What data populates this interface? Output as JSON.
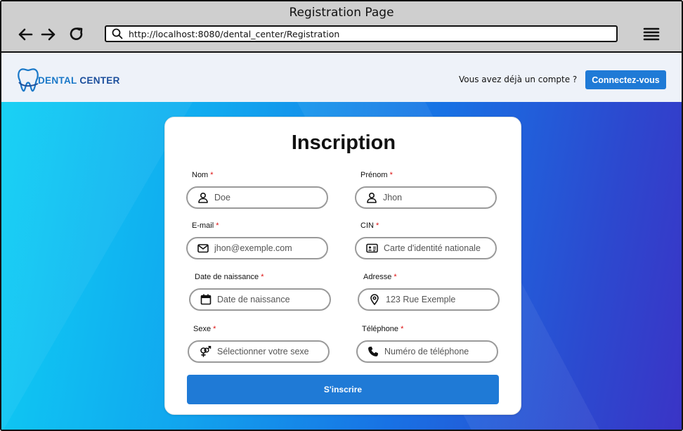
{
  "window": {
    "title": "Registration Page"
  },
  "browser": {
    "url": "http://localhost:8080/dental_center/Registration",
    "back_icon": "arrow-left-icon",
    "forward_icon": "arrow-right-icon",
    "reload_icon": "reload-icon",
    "search_icon": "search-icon",
    "menu_icon": "hamburger-menu-icon"
  },
  "header": {
    "logo": {
      "text_part1": "DENTAL",
      "text_part2": " CENTER",
      "icon": "tooth-icon"
    },
    "account_prompt": "Vous avez déjà un compte ?",
    "login_label": "Connectez-vous"
  },
  "form": {
    "title": "Inscription",
    "required_mark": "*",
    "fields": {
      "nom": {
        "label": "Nom",
        "placeholder": "Doe",
        "icon": "user-icon"
      },
      "prenom": {
        "label": "Prénom",
        "placeholder": "Jhon",
        "icon": "user-icon"
      },
      "email": {
        "label": "E-mail",
        "placeholder": "jhon@exemple.com",
        "icon": "envelope-icon"
      },
      "cin": {
        "label": "CIN",
        "placeholder": "Carte d'identité nationale",
        "icon": "id-card-icon"
      },
      "naissance": {
        "label": "Date de naissance",
        "placeholder": "Date de naissance",
        "icon": "calendar-icon"
      },
      "adresse": {
        "label": "Adresse",
        "placeholder": "123 Rue Exemple",
        "icon": "location-pin-icon"
      },
      "sexe": {
        "label": "Sexe",
        "placeholder": "Sélectionner votre sexe",
        "icon": "gender-icon"
      },
      "telephone": {
        "label": "Téléphone",
        "placeholder": "Numéro de téléphone",
        "icon": "phone-icon"
      }
    },
    "submit_label": "S'inscrire"
  },
  "colors": {
    "primary_button": "#1f7ad6",
    "required": "#dd1111",
    "gradient_start": "#0ecff4",
    "gradient_end": "#3a34c6",
    "header_bg": "#eef2f9"
  }
}
